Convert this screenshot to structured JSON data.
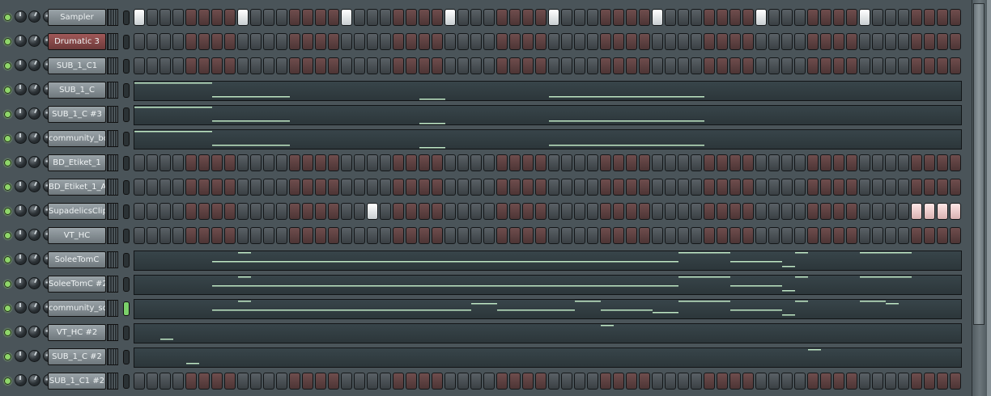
{
  "channel_rack": {
    "steps_per_pattern": 64,
    "channels": [
      {
        "name": "Sampler",
        "mode": "steps",
        "selected": false,
        "on": [
          0,
          8,
          16,
          24,
          32,
          40,
          48,
          56
        ],
        "red_on": []
      },
      {
        "name": "Drumatic 3",
        "mode": "steps",
        "selected": true,
        "on": [],
        "red_on": []
      },
      {
        "name": "SUB_1_C1",
        "mode": "steps",
        "selected": false,
        "on": [],
        "red_on": []
      },
      {
        "name": "SUB_1_C",
        "mode": "roll",
        "selected": false,
        "notes": [
          [
            0,
            6,
            0
          ],
          [
            6,
            12,
            4
          ],
          [
            22,
            24,
            5
          ],
          [
            32,
            44,
            4
          ]
        ]
      },
      {
        "name": "SUB_1_C #3",
        "mode": "roll",
        "selected": false,
        "notes": [
          [
            0,
            6,
            0
          ],
          [
            6,
            12,
            4
          ],
          [
            22,
            24,
            5
          ],
          [
            32,
            44,
            4
          ]
        ]
      },
      {
        "name": "community_bd",
        "mode": "roll",
        "selected": false,
        "notes": [
          [
            0,
            6,
            0
          ],
          [
            6,
            12,
            4
          ],
          [
            22,
            24,
            5
          ],
          [
            32,
            44,
            4
          ]
        ]
      },
      {
        "name": "BD_Etiket_1",
        "mode": "steps",
        "selected": false,
        "on": [],
        "red_on": []
      },
      {
        "name": "BD_Etiket_1_A",
        "mode": "steps",
        "selected": false,
        "on": [],
        "red_on": []
      },
      {
        "name": "SupadelicsClip",
        "mode": "steps",
        "selected": false,
        "on": [
          18
        ],
        "red_on": [
          60,
          61,
          62,
          63
        ]
      },
      {
        "name": "VT_HC",
        "mode": "steps",
        "selected": false,
        "on": [],
        "red_on": []
      },
      {
        "name": "SoleeTomC",
        "mode": "roll",
        "selected": false,
        "notes": [
          [
            6,
            42,
            2
          ],
          [
            8,
            9,
            0
          ],
          [
            42,
            46,
            0
          ],
          [
            46,
            50,
            2
          ],
          [
            50,
            51,
            4
          ],
          [
            51,
            52,
            0
          ],
          [
            56,
            58,
            0
          ],
          [
            58,
            60,
            0
          ]
        ]
      },
      {
        "name": "SoleeTomC #2",
        "mode": "roll",
        "selected": false,
        "notes": [
          [
            6,
            42,
            2
          ],
          [
            8,
            9,
            0
          ],
          [
            42,
            46,
            0
          ],
          [
            46,
            50,
            2
          ],
          [
            50,
            51,
            4
          ],
          [
            51,
            52,
            0
          ],
          [
            56,
            58,
            0
          ],
          [
            58,
            60,
            0
          ]
        ]
      },
      {
        "name": "community_sd",
        "mode": "roll",
        "selected": false,
        "active": true,
        "notes": [
          [
            6,
            16,
            2
          ],
          [
            8,
            9,
            0
          ],
          [
            16,
            25,
            2
          ],
          [
            25,
            26,
            2
          ],
          [
            26,
            28,
            1
          ],
          [
            28,
            34,
            2
          ],
          [
            34,
            36,
            0
          ],
          [
            36,
            40,
            2
          ],
          [
            40,
            42,
            3
          ],
          [
            42,
            44,
            0
          ],
          [
            44,
            46,
            0
          ],
          [
            46,
            50,
            2
          ],
          [
            50,
            51,
            4
          ],
          [
            51,
            52,
            0
          ],
          [
            56,
            57,
            0
          ],
          [
            57,
            58,
            0
          ],
          [
            58,
            59,
            1
          ]
        ]
      },
      {
        "name": "VT_HC #2",
        "mode": "roll",
        "selected": false,
        "notes": [
          [
            2,
            3,
            4
          ],
          [
            36,
            37,
            0
          ]
        ]
      },
      {
        "name": "SUB_1_C #2",
        "mode": "roll",
        "selected": false,
        "notes": [
          [
            4,
            5,
            4
          ],
          [
            52,
            53,
            0
          ]
        ]
      },
      {
        "name": "SUB_1_C1 #2",
        "mode": "steps",
        "selected": false,
        "on": [],
        "red_on": []
      }
    ]
  },
  "colors": {
    "background": "#4a5459",
    "step_gray": "#4a5155",
    "step_red": "#5e4242",
    "step_on": "#ffffff",
    "note": "#bfe7c4",
    "led": "#8fd66a"
  },
  "icons": {
    "led": "mute-led-icon",
    "pan": "pan-knob-icon",
    "vol": "volume-knob-icon",
    "pitch": "pitch-knob-icon"
  }
}
